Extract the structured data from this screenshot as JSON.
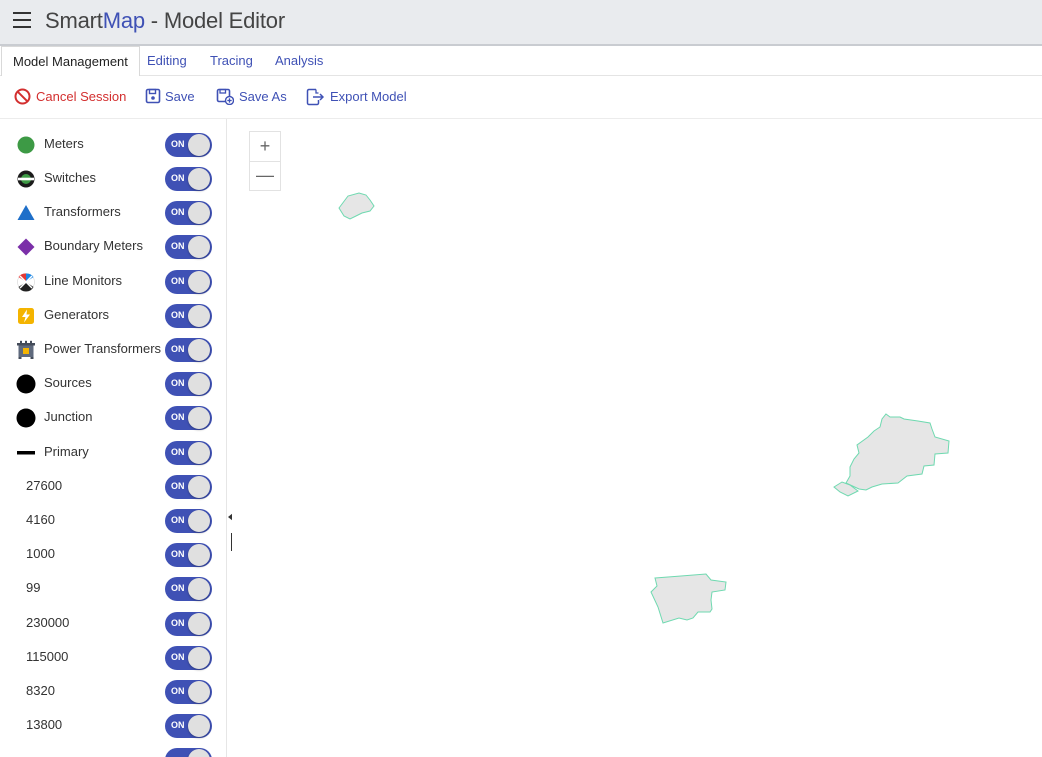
{
  "app": {
    "title_prefix": "Smart",
    "title_accent": "Map",
    "title_suffix": " - Model Editor"
  },
  "tabs": [
    {
      "label": "Model Management",
      "active": true
    },
    {
      "label": "Editing",
      "active": false
    },
    {
      "label": "Tracing",
      "active": false
    },
    {
      "label": "Analysis",
      "active": false
    }
  ],
  "toolbar": {
    "cancel_label": "Cancel Session",
    "save_label": "Save",
    "save_as_label": "Save As",
    "export_label": "Export Model"
  },
  "layers": [
    {
      "label": "Meters",
      "icon": "meter-icon",
      "state": "ON"
    },
    {
      "label": "Switches",
      "icon": "switch-icon",
      "state": "ON"
    },
    {
      "label": "Transformers",
      "icon": "transformer-icon",
      "state": "ON"
    },
    {
      "label": "Boundary Meters",
      "icon": "boundary-meter-icon",
      "state": "ON"
    },
    {
      "label": "Line Monitors",
      "icon": "line-monitor-icon",
      "state": "ON"
    },
    {
      "label": "Generators",
      "icon": "generator-icon",
      "state": "ON"
    },
    {
      "label": "Power Transformers",
      "icon": "power-transformer-icon",
      "state": "ON"
    },
    {
      "label": "Sources",
      "icon": "source-icon",
      "state": "ON"
    },
    {
      "label": "Junction",
      "icon": "junction-icon",
      "state": "ON"
    },
    {
      "label": "Primary",
      "icon": "primary-line-icon",
      "state": "ON"
    },
    {
      "label": "27600",
      "state": "ON"
    },
    {
      "label": "4160",
      "state": "ON"
    },
    {
      "label": "1000",
      "state": "ON"
    },
    {
      "label": "99",
      "state": "ON"
    },
    {
      "label": "230000",
      "state": "ON"
    },
    {
      "label": "115000",
      "state": "ON"
    },
    {
      "label": "8320",
      "state": "ON"
    },
    {
      "label": "13800",
      "state": "ON"
    }
  ],
  "map": {
    "zoom_in": "+",
    "zoom_out": "—",
    "polygon_fill": "#e6e6e6",
    "polygon_stroke": "#6fd9b0"
  },
  "colors": {
    "accent": "#3f51b5",
    "cancel": "#d32f2f"
  }
}
